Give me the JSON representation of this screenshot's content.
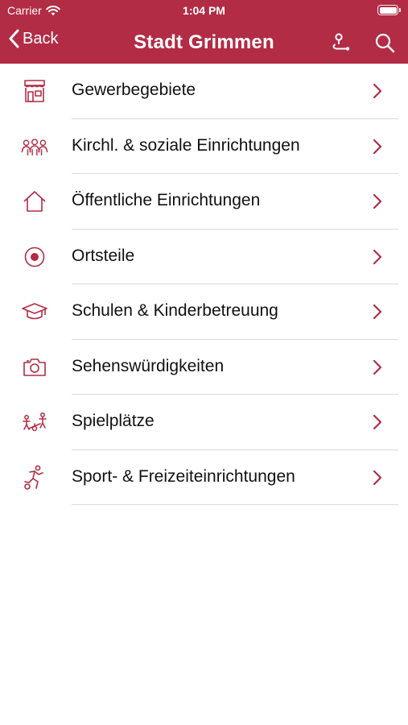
{
  "status_bar": {
    "carrier": "Carrier",
    "time": "1:04 PM",
    "wifi_icon": "wifi-icon",
    "battery_icon": "battery-icon"
  },
  "nav": {
    "back_label": "Back",
    "title": "Stadt Grimmen",
    "route_icon": "route-icon",
    "search_icon": "search-icon"
  },
  "colors": {
    "accent": "#b22c45",
    "icon": "#b22c45",
    "separator": "#d9d9d9"
  },
  "categories": [
    {
      "label": "Gewerbegebiete",
      "icon": "storefront-icon"
    },
    {
      "label": "Kirchl. & soziale Einrichtungen",
      "icon": "people-group-icon"
    },
    {
      "label": "Öffentliche Einrichtungen",
      "icon": "house-icon"
    },
    {
      "label": "Ortsteile",
      "icon": "location-dot-icon"
    },
    {
      "label": "Schulen & Kinderbetreuung",
      "icon": "graduation-cap-icon"
    },
    {
      "label": "Sehenswürdigkeiten",
      "icon": "camera-icon"
    },
    {
      "label": "Spielplätze",
      "icon": "playground-icon"
    },
    {
      "label": "Sport- & Freizeiteinrichtungen",
      "icon": "sport-runner-icon"
    }
  ]
}
